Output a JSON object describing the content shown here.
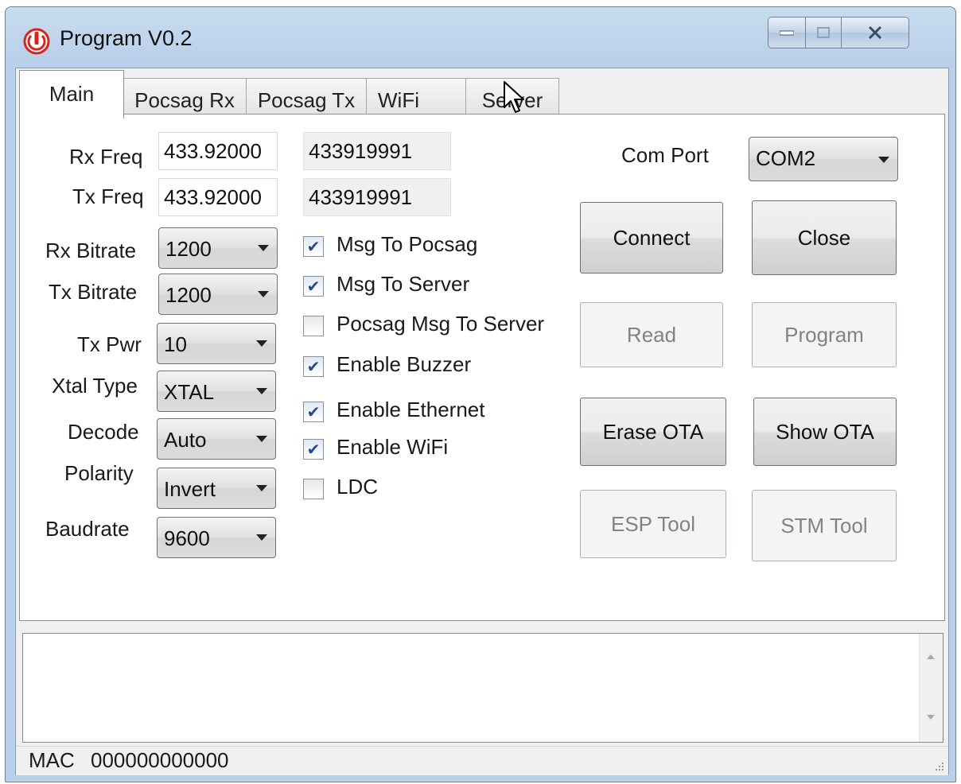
{
  "window": {
    "title": "Program V0.2"
  },
  "tabs": [
    {
      "label": "Main"
    },
    {
      "label": "Pocsag Rx"
    },
    {
      "label": "Pocsag Tx"
    },
    {
      "label": "WiFi"
    },
    {
      "label": "Server"
    }
  ],
  "main": {
    "rx_freq": {
      "label": "Rx Freq",
      "value": "433.92000",
      "readout": "433919991"
    },
    "tx_freq": {
      "label": "Tx Freq",
      "value": "433.92000",
      "readout": "433919991"
    },
    "rx_bitrate": {
      "label": "Rx Bitrate",
      "value": "1200"
    },
    "tx_bitrate": {
      "label": "Tx Bitrate",
      "value": "1200"
    },
    "tx_pwr": {
      "label": "Tx Pwr",
      "value": "10"
    },
    "xtal_type": {
      "label": "Xtal Type",
      "value": "XTAL"
    },
    "decode": {
      "label": "Decode",
      "value": "Auto"
    },
    "polarity": {
      "label": "Polarity",
      "value": "Invert"
    },
    "baudrate": {
      "label": "Baudrate",
      "value": "9600"
    },
    "checkboxes": [
      {
        "label": "Msg To Pocsag",
        "checked": true
      },
      {
        "label": "Msg To Server",
        "checked": true
      },
      {
        "label": "Pocsag Msg To Server",
        "checked": false
      },
      {
        "label": "Enable Buzzer",
        "checked": true
      },
      {
        "label": "Enable Ethernet",
        "checked": true
      },
      {
        "label": "Enable WiFi",
        "checked": true
      },
      {
        "label": "LDC",
        "checked": false
      }
    ],
    "com_port": {
      "label": "Com Port",
      "value": "COM2"
    },
    "buttons": {
      "connect": "Connect",
      "close": "Close",
      "read": "Read",
      "program": "Program",
      "erase_ota": "Erase OTA",
      "show_ota": "Show OTA",
      "esp_tool": "ESP Tool",
      "stm_tool": "STM Tool"
    }
  },
  "log": {
    "text": ""
  },
  "status": {
    "mac_label": "MAC",
    "mac_value": "000000000000"
  },
  "colors": {
    "title_bar": "#b8d0ea",
    "icon_red": "#d9241c",
    "check_blue": "#2a4a84"
  }
}
